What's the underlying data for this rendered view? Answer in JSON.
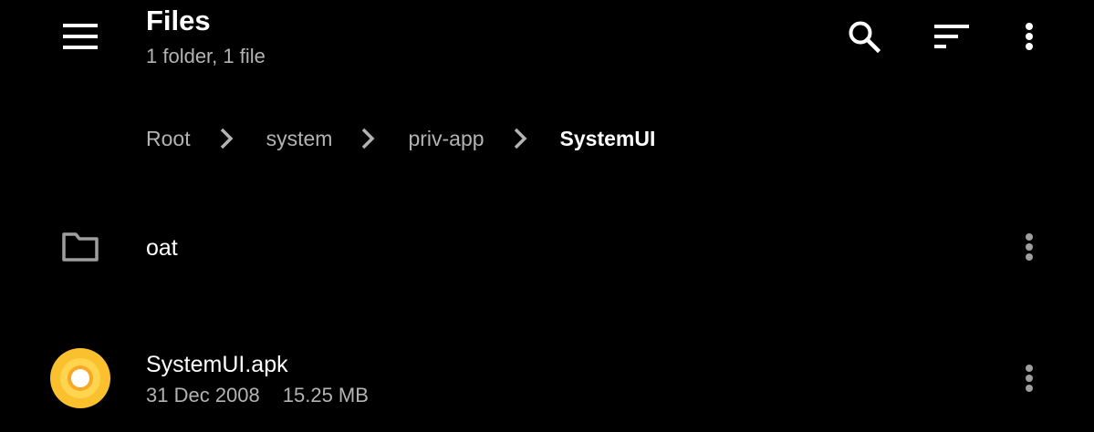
{
  "toolbar": {
    "title": "Files",
    "subtitle": "1 folder, 1 file",
    "icons": {
      "menu": "menu-icon",
      "search": "search-icon",
      "sort": "sort-icon",
      "more": "more-vert-icon"
    }
  },
  "breadcrumb": {
    "items": [
      {
        "label": "Root"
      },
      {
        "label": "system"
      },
      {
        "label": "priv-app"
      },
      {
        "label": "SystemUI",
        "current": true
      }
    ],
    "separator_icon": "chevron-right-icon"
  },
  "files": [
    {
      "name": "oat",
      "type": "folder",
      "icon": "folder-icon"
    },
    {
      "name": "SystemUI.apk",
      "type": "file",
      "icon": "apk-icon",
      "date": "31 Dec 2008",
      "size": "15.25 MB"
    }
  ],
  "colors": {
    "background": "#000000",
    "primary_text": "#ffffff",
    "secondary_text": "#b3b3b3",
    "icon_gray": "#9e9e9e",
    "apk_outer": "#fbc02d",
    "apk_inner": "#ffd54f"
  }
}
